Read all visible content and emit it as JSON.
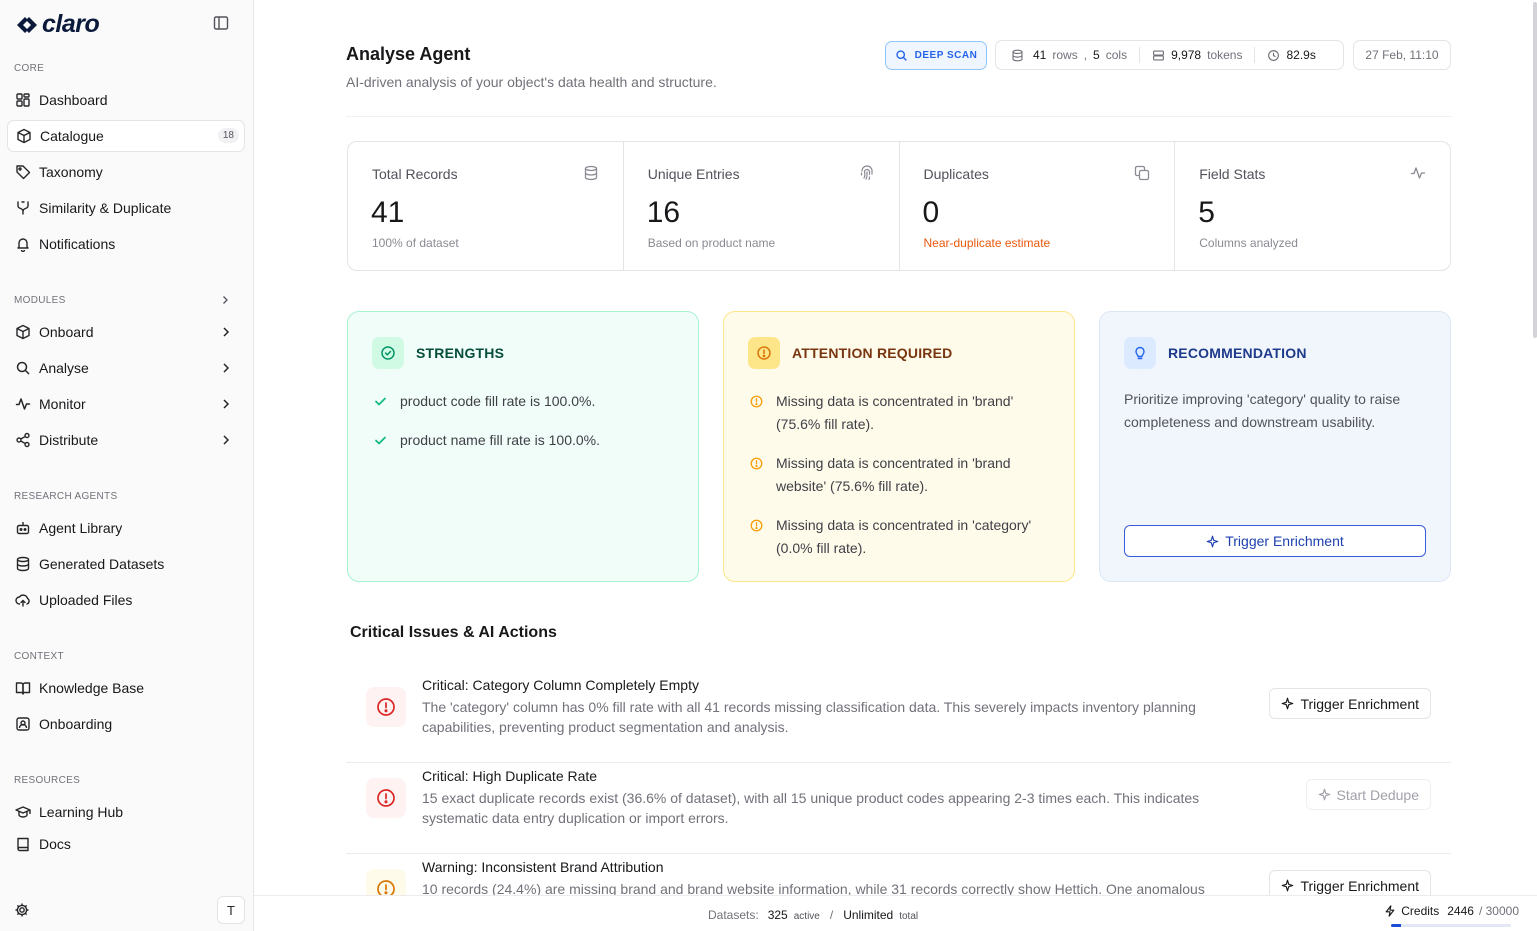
{
  "app": {
    "brand": "claro"
  },
  "sidebar": {
    "sections": {
      "core": "CORE",
      "modules": "MODULES",
      "research": "RESEARCH AGENTS",
      "context": "CONTEXT",
      "resources": "RESOURCES"
    },
    "core": [
      {
        "label": "Dashboard",
        "icon": "dashboard-icon"
      },
      {
        "label": "Catalogue",
        "icon": "box-icon",
        "badge": "18",
        "active": true
      },
      {
        "label": "Taxonomy",
        "icon": "tag-icon"
      },
      {
        "label": "Similarity & Duplicate",
        "icon": "merge-icon"
      },
      {
        "label": "Notifications",
        "icon": "bell-icon"
      }
    ],
    "modules": [
      {
        "label": "Onboard",
        "icon": "box-icon"
      },
      {
        "label": "Analyse",
        "icon": "search-icon"
      },
      {
        "label": "Monitor",
        "icon": "activity-icon"
      },
      {
        "label": "Distribute",
        "icon": "share-icon"
      }
    ],
    "research": [
      {
        "label": "Agent Library",
        "icon": "bot-icon"
      },
      {
        "label": "Generated Datasets",
        "icon": "database-icon"
      },
      {
        "label": "Uploaded Files",
        "icon": "upload-cloud-icon"
      }
    ],
    "context": [
      {
        "label": "Knowledge Base",
        "icon": "book-open-icon"
      },
      {
        "label": "Onboarding",
        "icon": "contact-icon"
      }
    ],
    "resources": [
      {
        "label": "Learning Hub",
        "icon": "graduation-cap-icon"
      },
      {
        "label": "Docs",
        "icon": "book-icon"
      }
    ],
    "user_initial": "T"
  },
  "header": {
    "title": "Analyse Agent",
    "subtitle": "AI-driven analysis of your object's data health and structure.",
    "deep_scan": "DEEP SCAN",
    "rows_value": "41",
    "rows_label": "rows",
    "comma": ",",
    "cols_value": "5",
    "cols_label": "cols",
    "tokens_value": "9,978",
    "tokens_label": "tokens",
    "duration": "82.9s",
    "date": "27 Feb, 11:10"
  },
  "metrics": [
    {
      "label": "Total Records",
      "value": "41",
      "note": "100% of dataset",
      "icon": "database-icon"
    },
    {
      "label": "Unique Entries",
      "value": "16",
      "note": "Based on product name",
      "icon": "fingerprint-icon"
    },
    {
      "label": "Duplicates",
      "value": "0",
      "note": "Near-duplicate estimate",
      "icon": "copy-icon"
    },
    {
      "label": "Field Stats",
      "value": "5",
      "note": "Columns analyzed",
      "icon": "activity-icon"
    }
  ],
  "strengths": {
    "title": "STRENGTHS",
    "items": [
      "product code fill rate is 100.0%.",
      "product name fill rate is 100.0%."
    ]
  },
  "attention": {
    "title": "ATTENTION REQUIRED",
    "items": [
      "Missing data is concentrated in 'brand' (75.6% fill rate).",
      "Missing data is concentrated in 'brand website' (75.6% fill rate).",
      "Missing data is concentrated in 'category' (0.0% fill rate)."
    ]
  },
  "recommendation": {
    "title": "RECOMMENDATION",
    "text": "Prioritize improving 'category' quality to raise completeness and downstream usability.",
    "button": "Trigger Enrichment"
  },
  "issues_title": "Critical Issues & AI Actions",
  "issues": [
    {
      "severity": "critical",
      "title": "Critical: Category Column Completely Empty",
      "desc": "The 'category' column has 0% fill rate with all 41 records missing classification data. This severely impacts inventory planning capabilities, preventing product segmentation and analysis.",
      "action": "Trigger Enrichment"
    },
    {
      "severity": "critical",
      "title": "Critical: High Duplicate Rate",
      "desc": "15 exact duplicate records exist (36.6% of dataset), with all 15 unique product codes appearing 2-3 times each. This indicates systematic data entry duplication or import errors.",
      "action": "Start Dedupe"
    },
    {
      "severity": "warning",
      "title": "Warning: Inconsistent Brand Attribution",
      "desc": "10 records (24.4%) are missing brand and brand website information, while 31 records correctly show Hettich. One anomalous",
      "action": "Trigger Enrichment"
    }
  ],
  "footer": {
    "datasets_label": "Datasets:",
    "active_count": "325",
    "active_label": "active",
    "divider": "/",
    "total_value": "Unlimited",
    "total_label": "total",
    "credits_label": "Credits",
    "credits_used": "2446",
    "credits_max": "/ 30000",
    "credits_fraction": 0.08
  }
}
